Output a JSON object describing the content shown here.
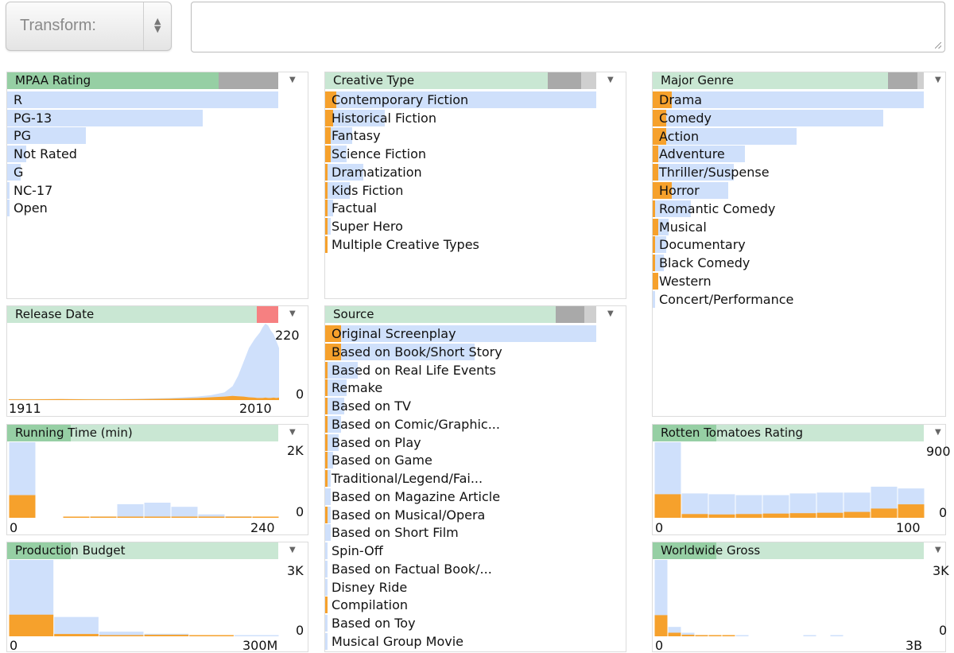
{
  "toolbar": {
    "transform_label": "Transform:",
    "query_value": ""
  },
  "colors": {
    "header_bg": "#c9e7d3",
    "header_fill": "#96cfa4",
    "bar_base": "#cfe0fb",
    "bar_selected": "#f6a12c",
    "segment_gray": "#a9a9a9",
    "segment_red": "#f68081"
  },
  "panels": {
    "mpaa": {
      "title": "MPAA Rating",
      "items": [
        {
          "label": "R",
          "count": 1.0,
          "selected": 0
        },
        {
          "label": "PG-13",
          "count": 0.72,
          "selected": 0
        },
        {
          "label": "PG",
          "count": 0.29,
          "selected": 0
        },
        {
          "label": "Not Rated",
          "count": 0.07,
          "selected": 0
        },
        {
          "label": "G",
          "count": 0.05,
          "selected": 0
        },
        {
          "label": "NC-17",
          "count": 0.01,
          "selected": 0
        },
        {
          "label": "Open",
          "count": 0.01,
          "selected": 0
        }
      ]
    },
    "creative": {
      "title": "Creative Type",
      "items": [
        {
          "label": "Contemporary Fiction",
          "count": 1.0,
          "selected": 0.04
        },
        {
          "label": "Historical Fiction",
          "count": 0.22,
          "selected": 0.03
        },
        {
          "label": "Fantasy",
          "count": 0.1,
          "selected": 0.02
        },
        {
          "label": "Science Fiction",
          "count": 0.08,
          "selected": 0.02
        },
        {
          "label": "Dramatization",
          "count": 0.14,
          "selected": 0.01
        },
        {
          "label": "Kids Fiction",
          "count": 0.09,
          "selected": 0.01
        },
        {
          "label": "Factual",
          "count": 0.03,
          "selected": 0.01
        },
        {
          "label": "Super Hero",
          "count": 0.02,
          "selected": 0.01
        },
        {
          "label": "Multiple Creative Types",
          "count": 0.01,
          "selected": 0.01
        }
      ]
    },
    "genre": {
      "title": "Major Genre",
      "items": [
        {
          "label": "Drama",
          "count": 1.0,
          "selected": 0.07
        },
        {
          "label": "Comedy",
          "count": 0.85,
          "selected": 0.05
        },
        {
          "label": "Action",
          "count": 0.53,
          "selected": 0.05
        },
        {
          "label": "Adventure",
          "count": 0.34,
          "selected": 0.02
        },
        {
          "label": "Thriller/Suspense",
          "count": 0.3,
          "selected": 0.02
        },
        {
          "label": "Horror",
          "count": 0.28,
          "selected": 0.07
        },
        {
          "label": "Romantic Comedy",
          "count": 0.14,
          "selected": 0.01
        },
        {
          "label": "Musical",
          "count": 0.06,
          "selected": 0.02
        },
        {
          "label": "Documentary",
          "count": 0.05,
          "selected": 0.01
        },
        {
          "label": "Black Comedy",
          "count": 0.04,
          "selected": 0.01
        },
        {
          "label": "Western",
          "count": 0.02,
          "selected": 0.02
        },
        {
          "label": "Concert/Performance",
          "count": 0.01,
          "selected": 0
        }
      ]
    },
    "source": {
      "title": "Source",
      "items": [
        {
          "label": "Original Screenplay",
          "count": 1.0,
          "selected": 0.06
        },
        {
          "label": "Based on Book/Short Story",
          "count": 0.55,
          "selected": 0.06
        },
        {
          "label": "Based on Real Life Events",
          "count": 0.12,
          "selected": 0.01
        },
        {
          "label": "Remake",
          "count": 0.08,
          "selected": 0.01
        },
        {
          "label": "Based on TV",
          "count": 0.07,
          "selected": 0.01
        },
        {
          "label": "Based on Comic/Graphic...",
          "count": 0.06,
          "selected": 0.01
        },
        {
          "label": "Based on Play",
          "count": 0.05,
          "selected": 0.01
        },
        {
          "label": "Based on Game",
          "count": 0.03,
          "selected": 0.01
        },
        {
          "label": "Traditional/Legend/Fai...",
          "count": 0.02,
          "selected": 0.01
        },
        {
          "label": "Based on Magazine Article",
          "count": 0.02,
          "selected": 0
        },
        {
          "label": "Based on Musical/Opera",
          "count": 0.02,
          "selected": 0.01
        },
        {
          "label": "Based on Short Film",
          "count": 0.02,
          "selected": 0
        },
        {
          "label": "Spin-Off",
          "count": 0.01,
          "selected": 0
        },
        {
          "label": "Based on Factual Book/...",
          "count": 0.01,
          "selected": 0
        },
        {
          "label": "Disney Ride",
          "count": 0.01,
          "selected": 0
        },
        {
          "label": "Compilation",
          "count": 0.01,
          "selected": 0.01
        },
        {
          "label": "Based on Toy",
          "count": 0.01,
          "selected": 0
        },
        {
          "label": "Musical Group Movie",
          "count": 0.01,
          "selected": 0
        }
      ]
    },
    "release": {
      "title": "Release Date",
      "ymax_label": "220",
      "ymin_label": "0",
      "xmin_label": "1911",
      "xmax_label": "2010"
    },
    "running": {
      "title": "Running Time (min)",
      "ymax_label": "2K",
      "ymin_label": "0",
      "xmin_label": "0",
      "xmax_label": "240"
    },
    "budget": {
      "title": "Production Budget",
      "ymax_label": "3K",
      "ymin_label": "0",
      "xmin_label": "0",
      "xmax_label": "300M"
    },
    "rotten": {
      "title": "Rotten Tomatoes Rating",
      "ymax_label": "900",
      "ymin_label": "0",
      "xmin_label": "0",
      "xmax_label": "100"
    },
    "gross": {
      "title": "Worldwide Gross",
      "ymax_label": "3K",
      "ymin_label": "0",
      "xmin_label": "0",
      "xmax_label": "3B"
    }
  },
  "chart_data": [
    {
      "type": "area",
      "x_range": [
        1911,
        2010
      ],
      "ylim": [
        0,
        220
      ],
      "series": [
        {
          "x": [
            1911,
            1920,
            1930,
            1940,
            1950,
            1960,
            1970,
            1980,
            1985,
            1990,
            1993,
            1995,
            1997,
            1999,
            2001,
            2002,
            2003,
            2004,
            2005,
            2006,
            2007,
            2008,
            2009,
            2010
          ],
          "values": [
            3,
            3,
            3,
            3,
            3,
            4,
            6,
            10,
            14,
            22,
            40,
            70,
            110,
            150,
            175,
            185,
            195,
            210,
            220,
            215,
            200,
            190,
            170,
            150
          ]
        },
        {
          "x": [
            1911,
            1920,
            1930,
            1940,
            1950,
            1960,
            1970,
            1980,
            1985,
            1990,
            1993,
            1995,
            1997,
            1999,
            2001,
            2002,
            2003,
            2004,
            2005,
            2006,
            2007,
            2008,
            2009,
            2010
          ],
          "values": [
            2,
            2,
            3,
            2,
            2,
            3,
            4,
            6,
            8,
            10,
            12,
            11,
            10,
            8,
            7,
            6,
            6,
            6,
            7,
            6,
            6,
            7,
            6,
            7
          ]
        }
      ]
    },
    {
      "type": "bar",
      "x_range": [
        0,
        240
      ],
      "ylim": [
        0,
        2000
      ],
      "bins": [
        0,
        24,
        48,
        72,
        96,
        120,
        144,
        168,
        192,
        216
      ],
      "series": [
        {
          "values": [
            2000,
            0,
            20,
            35,
            360,
            400,
            290,
            90,
            40,
            30
          ]
        },
        {
          "values": [
            600,
            0,
            5,
            10,
            30,
            30,
            25,
            10,
            5,
            5
          ]
        }
      ]
    },
    {
      "type": "bar",
      "x_range": [
        0,
        300000000
      ],
      "ylim": [
        0,
        3000
      ],
      "bins": [
        0,
        50000000,
        100000000,
        150000000,
        200000000,
        250000000
      ],
      "series": [
        {
          "values": [
            3000,
            760,
            180,
            100,
            40,
            20
          ]
        },
        {
          "values": [
            850,
            90,
            40,
            60,
            10,
            0
          ]
        }
      ]
    },
    {
      "type": "bar",
      "x_range": [
        0,
        100
      ],
      "ylim": [
        0,
        900
      ],
      "bins": [
        0,
        10,
        20,
        30,
        40,
        50,
        60,
        70,
        80,
        90
      ],
      "series": [
        {
          "values": [
            900,
            290,
            280,
            270,
            270,
            290,
            300,
            300,
            370,
            350
          ]
        },
        {
          "values": [
            280,
            45,
            40,
            45,
            50,
            55,
            60,
            70,
            110,
            160
          ]
        }
      ]
    },
    {
      "type": "bar",
      "x_range": [
        0,
        3000000000
      ],
      "ylim": [
        0,
        3000
      ],
      "bins": [
        0,
        150000000,
        300000000,
        450000000,
        600000000,
        750000000,
        900000000,
        1050000000,
        1200000000,
        1350000000,
        1500000000,
        1650000000,
        1800000000,
        1950000000
      ],
      "series": [
        {
          "values": [
            3000,
            370,
            140,
            50,
            30,
            20,
            10,
            0,
            0,
            0,
            0,
            20,
            0,
            10
          ]
        },
        {
          "values": [
            830,
            140,
            60,
            20,
            10,
            10,
            0,
            0,
            0,
            0,
            0,
            0,
            0,
            0
          ]
        }
      ]
    }
  ]
}
